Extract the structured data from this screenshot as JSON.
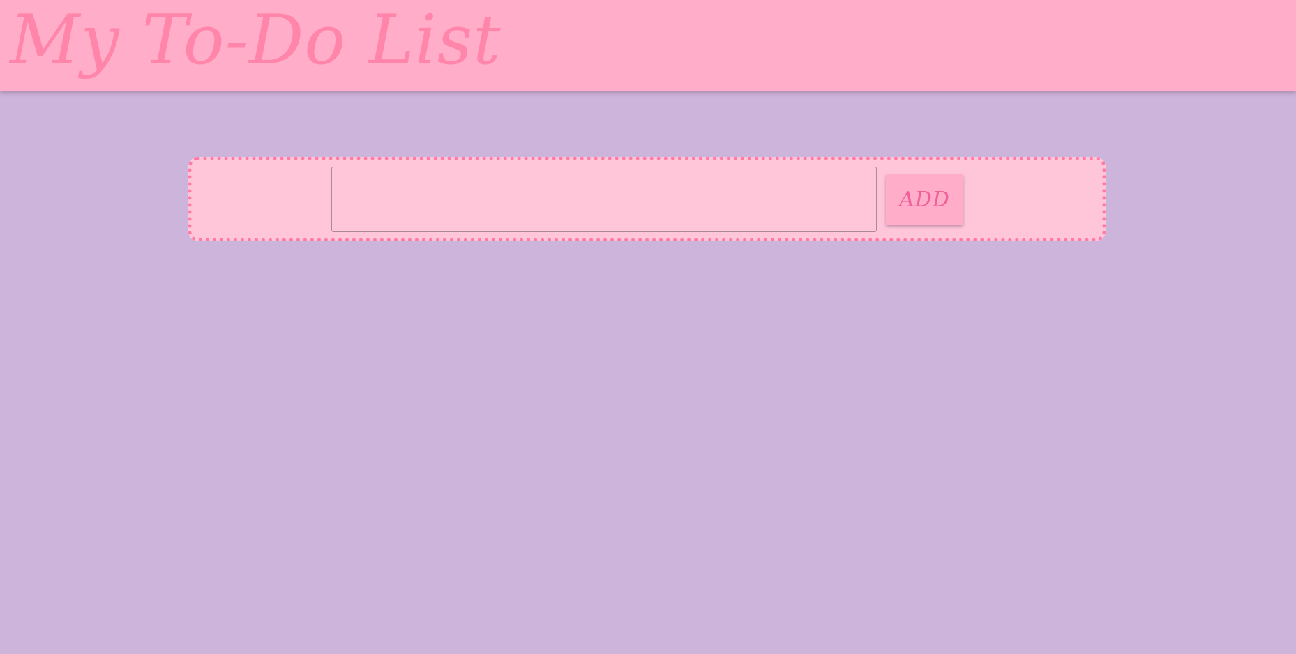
{
  "header": {
    "title": "My To-Do List"
  },
  "todo_form": {
    "input_value": "",
    "input_placeholder": "",
    "add_label": "ADD"
  },
  "colors": {
    "background": "#cdb4da",
    "header": "#ffadc8",
    "title_text": "#ff85aa",
    "card": "#ffc5d9",
    "card_dotted_border": "#ff7aa4",
    "button": "#ffadc8",
    "button_text": "#f0609a"
  }
}
